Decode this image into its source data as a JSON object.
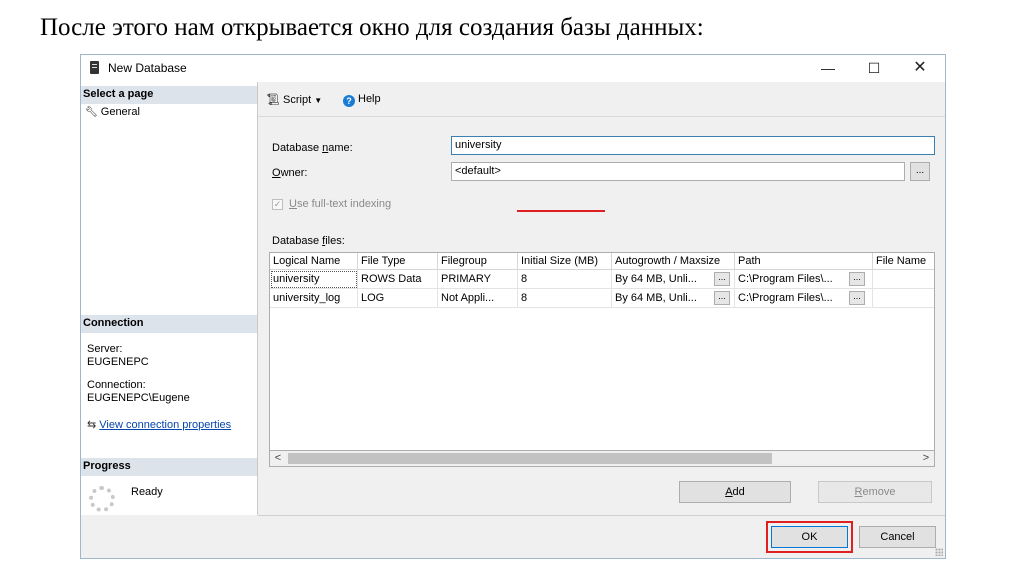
{
  "caption": "После этого нам открывается окно для создания базы данных:",
  "window": {
    "title": "New Database",
    "minimize": "—",
    "maximize": "☐",
    "close": "✕"
  },
  "left": {
    "select_page": "Select a page",
    "pages": [
      "General"
    ],
    "connection_header": "Connection",
    "server_label": "Server:",
    "server_value": "EUGENEPC",
    "connection_label": "Connection:",
    "connection_value": "EUGENEPC\\Eugene",
    "view_props": "View connection properties",
    "progress_header": "Progress",
    "progress_status": "Ready"
  },
  "toolbar": {
    "script": "Script",
    "help": "Help"
  },
  "form": {
    "db_name_label_pre": "Database ",
    "db_name_label_u": "n",
    "db_name_label_post": "ame:",
    "db_name_value": "university",
    "owner_label_u": "O",
    "owner_label_post": "wner:",
    "owner_value": "<default>",
    "fulltext_label_u": "U",
    "fulltext_label_post": "se full-text indexing",
    "files_label_pre": "Database ",
    "files_label_u": "f",
    "files_label_post": "iles:",
    "browse": "..."
  },
  "grid": {
    "columns": [
      "Logical Name",
      "File Type",
      "Filegroup",
      "Initial Size (MB)",
      "Autogrowth / Maxsize",
      "Path",
      "File Name"
    ],
    "rows": [
      [
        "university",
        "ROWS Data",
        "PRIMARY",
        "8",
        "By 64 MB, Unli...",
        "C:\\Program Files\\...",
        ""
      ],
      [
        "university_log",
        "LOG",
        "Not Appli...",
        "8",
        "By 64 MB, Unli...",
        "C:\\Program Files\\...",
        ""
      ]
    ]
  },
  "buttons": {
    "add_u": "A",
    "add_post": "dd",
    "remove_u": "R",
    "remove_post": "emove",
    "ok": "OK",
    "cancel": "Cancel"
  }
}
